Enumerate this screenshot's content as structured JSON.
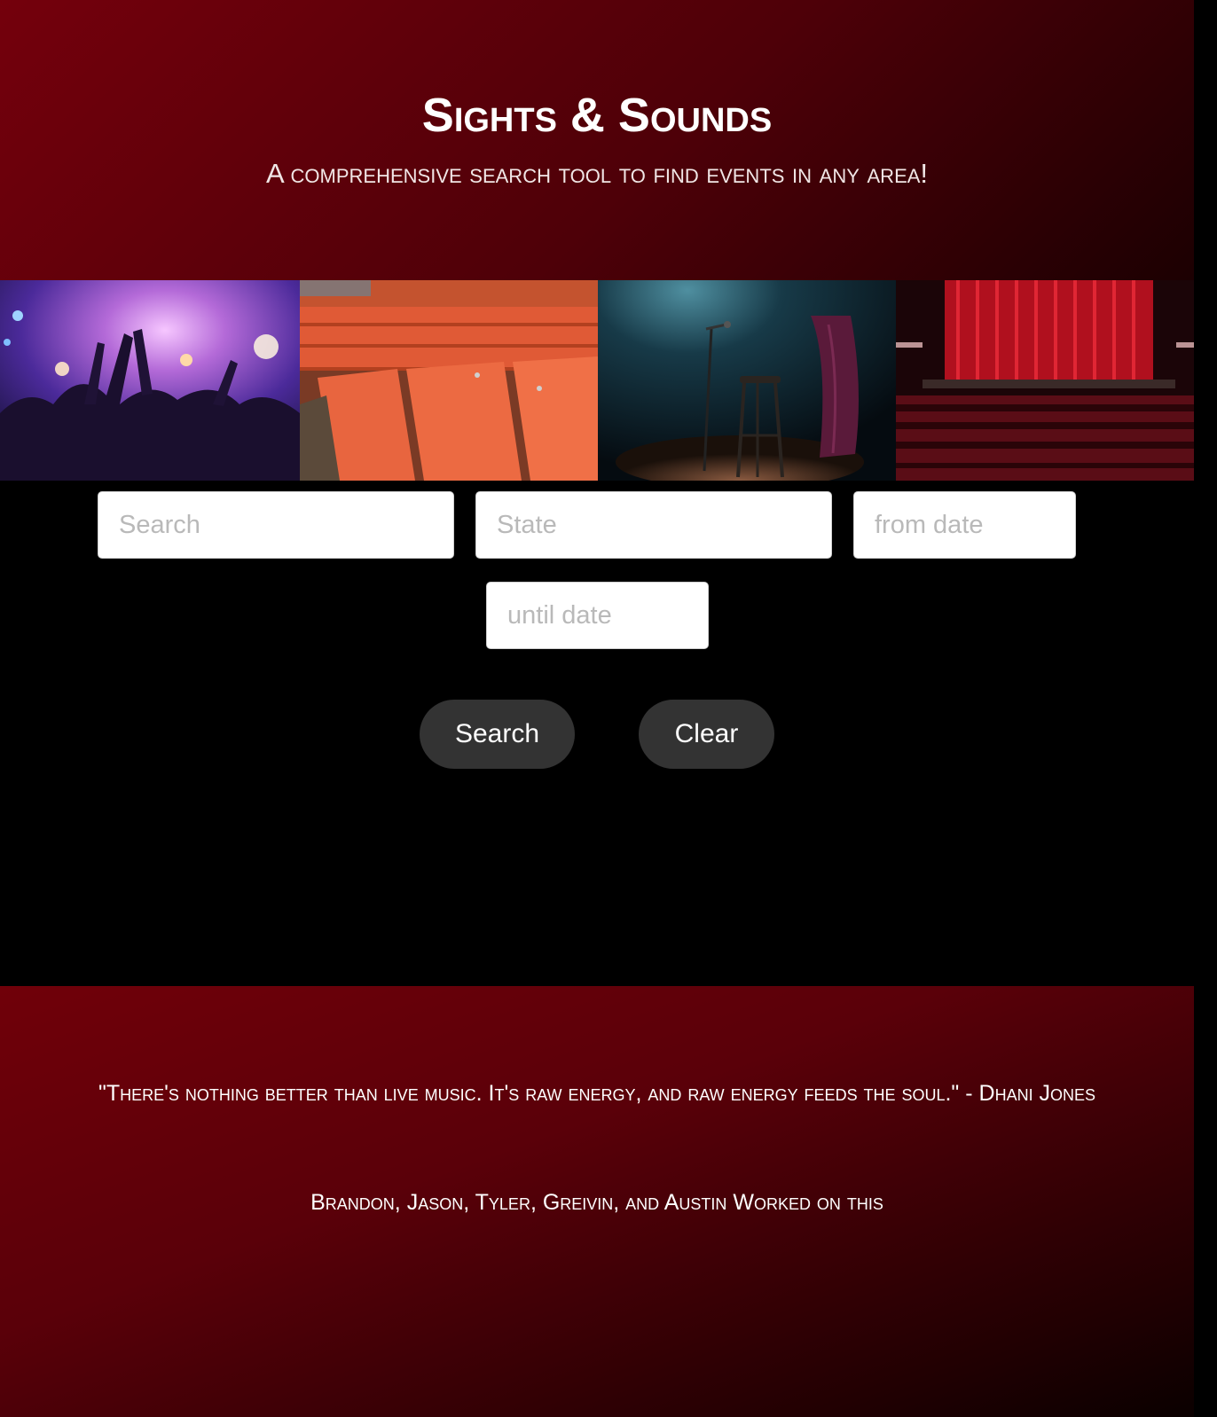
{
  "header": {
    "title": "Sights & Sounds",
    "subtitle": "A comprehensive search tool to find events in any area!"
  },
  "gallery": {
    "images": [
      {
        "name": "concert-crowd-image"
      },
      {
        "name": "stadium-seats-image"
      },
      {
        "name": "comedy-stage-microphone-image"
      },
      {
        "name": "theater-curtain-image"
      }
    ]
  },
  "search": {
    "keyword_placeholder": "Search",
    "state_placeholder": "State",
    "from_date_placeholder": "from date",
    "until_date_placeholder": "until date",
    "search_label": "Search",
    "clear_label": "Clear"
  },
  "footer": {
    "quote": "\"There's nothing better than live music. It's raw energy, and raw energy feeds the soul.\" - Dhani Jones",
    "credits": "Brandon, Jason, Tyler, Greivin, and Austin Worked on this"
  },
  "colors": {
    "brand_red": "#74000c",
    "button_bg": "#333333"
  }
}
